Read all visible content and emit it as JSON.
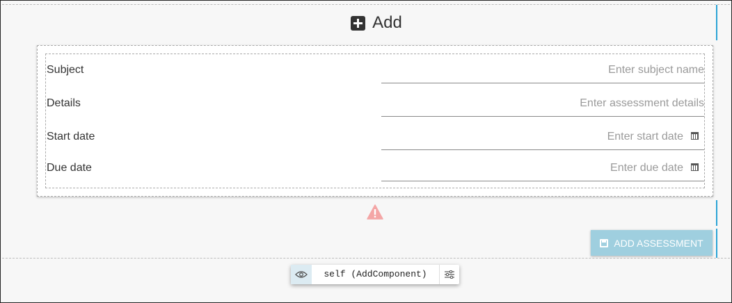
{
  "header": {
    "title": "Add",
    "icon": "plus-square-icon"
  },
  "form": {
    "fields": [
      {
        "label": "Subject",
        "placeholder": "Enter subject name",
        "value": ""
      },
      {
        "label": "Details",
        "placeholder": "Enter assessment details",
        "value": ""
      },
      {
        "label": "Start date",
        "placeholder": "Enter start date",
        "value": "",
        "icon": "calendar-icon"
      },
      {
        "label": "Due date",
        "placeholder": "Enter due date",
        "value": "",
        "icon": "calendar-icon"
      }
    ]
  },
  "warning": {
    "icon": "warning-triangle-icon",
    "color": "#f4a6a6"
  },
  "actions": {
    "submit_label": "ADD ASSESSMENT",
    "submit_icon": "floppy-disk-icon",
    "button_color": "#9fcfdf"
  },
  "debug": {
    "label": "self (AddComponent)",
    "left_icon": "eye-icon",
    "right_icon": "sliders-icon"
  },
  "colors": {
    "accent": "#2aa3d6"
  }
}
